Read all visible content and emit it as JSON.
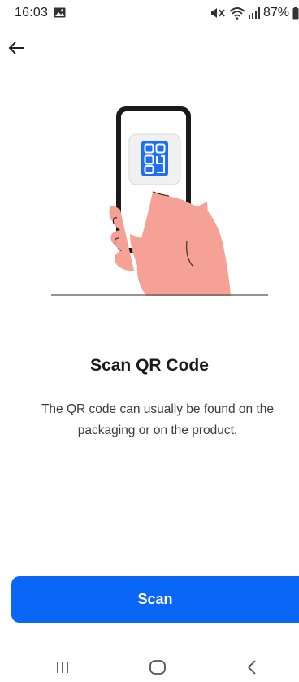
{
  "status_bar": {
    "time": "16:03",
    "battery": "87%",
    "icons": [
      "gallery-icon",
      "mute-icon",
      "wifi-icon",
      "signal-icon",
      "battery-icon"
    ]
  },
  "header": {
    "back_icon": "arrow-left-icon"
  },
  "illustration": {
    "icon": "qr-code-icon",
    "accent_color": "#1f6ff2",
    "hand_color": "#f5a196"
  },
  "main": {
    "title": "Scan QR Code",
    "description": "The QR code can usually be found on the packaging or on the product."
  },
  "actions": {
    "scan_label": "Scan",
    "button_color": "#0a66f5"
  },
  "nav_bar": {
    "icons": [
      "recent-apps-icon",
      "home-icon",
      "back-nav-icon"
    ]
  }
}
